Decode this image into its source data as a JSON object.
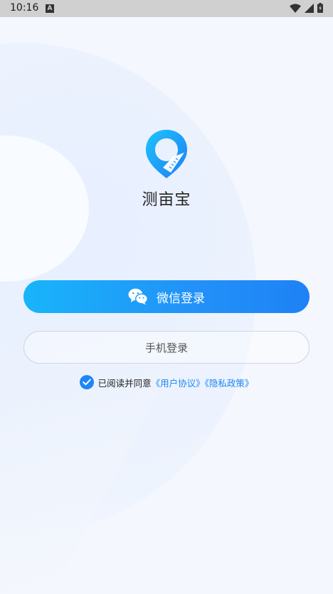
{
  "status_bar": {
    "time": "10:16",
    "notification_icon": "A"
  },
  "app": {
    "name": "测亩宝"
  },
  "buttons": {
    "wechat_label": "微信登录",
    "phone_label": "手机登录"
  },
  "agreement": {
    "prefix": "已阅读并同意",
    "user_agreement": "《用户协议》",
    "privacy_policy": "《隐私政策》"
  },
  "colors": {
    "accent": "#1f86f5",
    "button_start": "#18b5fa",
    "button_end": "#1e82f6"
  },
  "icons": [
    "wifi-icon",
    "signal-icon",
    "battery-icon",
    "wechat-icon",
    "check-icon"
  ]
}
